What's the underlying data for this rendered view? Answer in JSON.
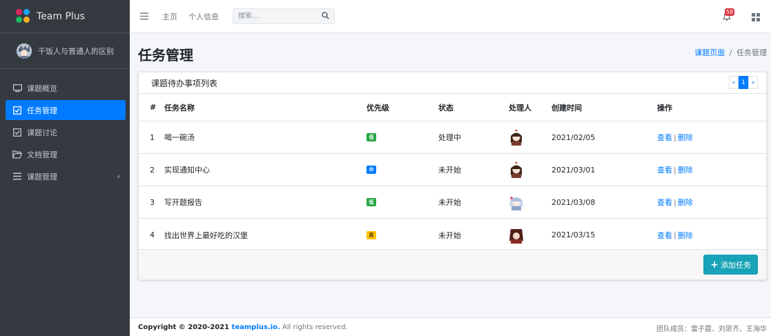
{
  "brand": {
    "name": "Team Plus"
  },
  "user": {
    "name": "干饭人与普通人的区别"
  },
  "sidebar": {
    "items": [
      {
        "label": "课题概览",
        "icon": "monitor-icon"
      },
      {
        "label": "任务管理",
        "icon": "checkbox-icon",
        "active": true
      },
      {
        "label": "课题讨论",
        "icon": "checkbox-icon"
      },
      {
        "label": "文档管理",
        "icon": "folder-icon"
      },
      {
        "label": "课题管理",
        "icon": "menu-icon",
        "has_chevron": true,
        "chevron": "‹"
      }
    ]
  },
  "navbar": {
    "links": [
      "主页",
      "个人信息"
    ],
    "search_placeholder": "搜索...",
    "notification_count": "58"
  },
  "page": {
    "title": "任务管理",
    "breadcrumb": {
      "parent": "课题页面",
      "separator": "/",
      "current": "任务管理"
    }
  },
  "card": {
    "title": "课题待办事项列表",
    "pagination": {
      "prev": "«",
      "current": "1",
      "next": "»"
    },
    "columns": {
      "num": "#",
      "name": "任务名称",
      "priority": "优先级",
      "status": "状态",
      "owner": "处理人",
      "created": "创建时间",
      "ops": "操作"
    },
    "rows": [
      {
        "num": "1",
        "name": "喝一碗汤",
        "priority": "低",
        "priority_color": "#28a745",
        "status": "处理中",
        "owner_avatar": "avatar-girl-1-icon",
        "created": "2021/02/05",
        "view": "查看",
        "sep": "|",
        "delete": "删除"
      },
      {
        "num": "2",
        "name": "实现通知中心",
        "priority": "中",
        "priority_color": "#007bff",
        "status": "未开始",
        "owner_avatar": "avatar-girl-1-icon",
        "created": "2021/03/01",
        "view": "查看",
        "sep": "|",
        "delete": "删除"
      },
      {
        "num": "3",
        "name": "写开题报告",
        "priority": "低",
        "priority_color": "#28a745",
        "status": "未开始",
        "owner_avatar": "avatar-girl-2-icon",
        "created": "2021/03/08",
        "view": "查看",
        "sep": "|",
        "delete": "删除"
      },
      {
        "num": "4",
        "name": "找出世界上最好吃的汉堡",
        "priority": "高",
        "priority_color": "#ffc107",
        "status": "未开始",
        "owner_avatar": "avatar-girl-3-icon",
        "created": "2021/03/15",
        "view": "查看",
        "sep": "|",
        "delete": "删除"
      }
    ],
    "add_button": "添加任务"
  },
  "footer": {
    "copyright_prefix": "Copyright © 2020-2021 ",
    "site": "teamplus.io.",
    "copyright_suffix": " All rights reserved.",
    "team": "团队成员：雷子霆、刘思齐、王海华"
  },
  "colors": {
    "sidebar_bg": "#343a40",
    "primary": "#007bff",
    "info": "#17a2b8",
    "success": "#28a745",
    "warning": "#ffc107",
    "danger": "#dc3545"
  }
}
